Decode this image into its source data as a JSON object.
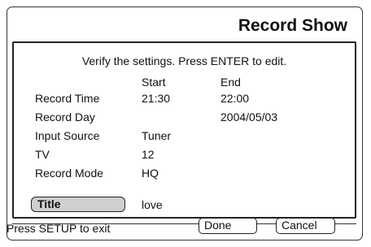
{
  "header": {
    "title": "Record Show"
  },
  "instruction": "Verify the settings. Press ENTER to edit.",
  "columns": {
    "start": "Start",
    "end": "End"
  },
  "rows": [
    {
      "label": "Record Time",
      "start": "21:30",
      "end": "22:00"
    },
    {
      "label": "Record Day",
      "start": "",
      "end": "2004/05/03"
    },
    {
      "label": "Input Source",
      "start": "Tuner",
      "end": ""
    },
    {
      "label": "TV",
      "start": "12",
      "end": ""
    },
    {
      "label": "Record Mode",
      "start": "HQ",
      "end": ""
    }
  ],
  "title_field": {
    "label": "Title",
    "value": "love"
  },
  "footer": {
    "hint": "Press SETUP to exit",
    "done_label": "Done",
    "cancel_label": "Cancel"
  }
}
